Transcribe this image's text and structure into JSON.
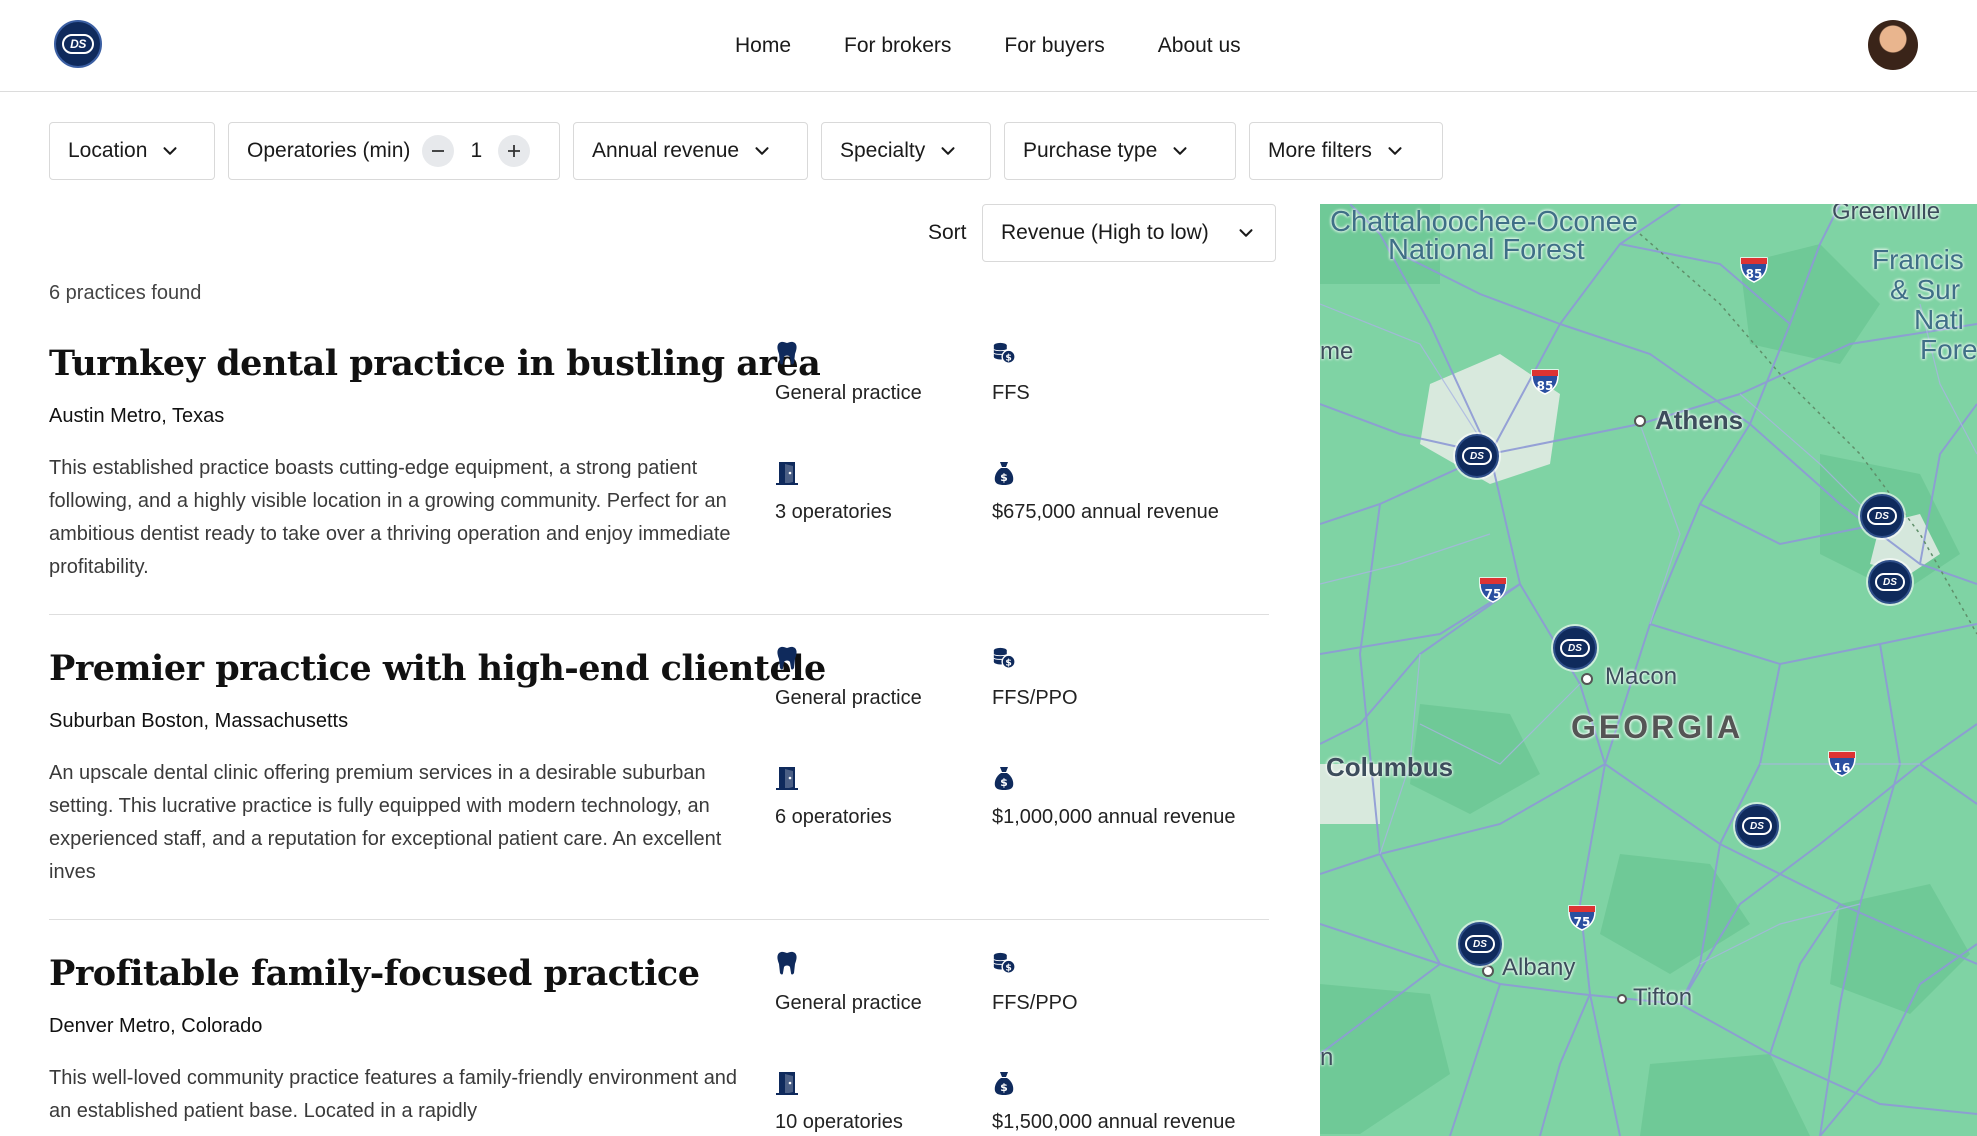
{
  "header": {
    "logo_text": "DS",
    "nav": [
      "Home",
      "For brokers",
      "For buyers",
      "About us"
    ]
  },
  "filters": {
    "location": "Location",
    "operatories": "Operatories (min)",
    "operatories_value": "1",
    "annual_revenue": "Annual revenue",
    "specialty": "Specialty",
    "purchase_type": "Purchase type",
    "more_filters": "More filters"
  },
  "sort": {
    "label": "Sort",
    "value": "Revenue (High to low)"
  },
  "results_count": "6 practices found",
  "listings": [
    {
      "title": "Turnkey dental practice in bustling area",
      "location": "Austin Metro, Texas",
      "description": "This established practice boasts cutting-edge equipment, a strong patient following, and a highly visible location in a growing community. Perfect for an ambitious dentist ready to take over a thriving operation and enjoy immediate profitability.",
      "specialty": "General practice",
      "payment": "FFS",
      "operatories": "3 operatories",
      "revenue": "$675,000 annual revenue"
    },
    {
      "title": "Premier practice with high-end clientele",
      "location": "Suburban Boston, Massachusetts",
      "description": "An upscale dental clinic offering premium services in a desirable suburban setting. This lucrative practice is fully equipped with modern technology, an experienced staff, and a reputation for exceptional patient care. An excellent inves",
      "specialty": "General practice",
      "payment": "FFS/PPO",
      "operatories": "6 operatories",
      "revenue": "$1,000,000 annual revenue"
    },
    {
      "title": "Profitable family-focused practice",
      "location": "Denver Metro, Colorado",
      "description": "This well-loved community practice features a family-friendly environment and an established patient base. Located in a rapidly",
      "specialty": "General practice",
      "payment": "FFS/PPO",
      "operatories": "10 operatories",
      "revenue": "$1,500,000 annual revenue"
    }
  ],
  "map": {
    "labels": {
      "forest1": "Chattahoochee-Oconee",
      "forest2": "National Forest",
      "greenville": "Greenville",
      "francis1": "Francis",
      "francis2": "& Sur",
      "francis3": "Nati",
      "francis4": "Fore",
      "me": "me",
      "athens": "Athens",
      "macon": "Macon",
      "georgia": "GEORGIA",
      "columbus": "Columbus",
      "albany": "Albany",
      "tifton": "Tifton",
      "n": "n"
    },
    "highways": [
      "85",
      "85",
      "75",
      "75",
      "16"
    ],
    "pin_text": "DS",
    "colors": {
      "land": "#7fd3a4",
      "road": "#8e9ad6",
      "pin": "#0f2a5c"
    }
  },
  "colors": {
    "brand": "#0f2a5c",
    "border": "#d9d9d9"
  }
}
